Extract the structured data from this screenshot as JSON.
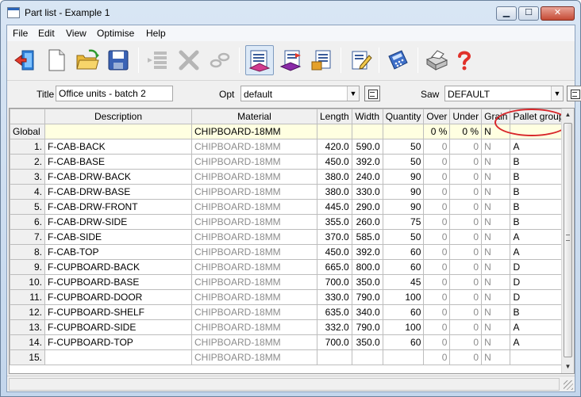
{
  "window": {
    "title": "Part list - Example 1",
    "controls": {
      "minimize": "▁",
      "maximize": "☐",
      "close": "✕"
    }
  },
  "menu": [
    "File",
    "Edit",
    "View",
    "Optimise",
    "Help"
  ],
  "toolbar": {
    "buttons": [
      {
        "name": "exit-icon"
      },
      {
        "name": "new-document-icon"
      },
      {
        "name": "open-folder-icon"
      },
      {
        "name": "save-disk-icon"
      },
      {
        "name": "insert-rows-icon"
      },
      {
        "name": "delete-cross-icon"
      },
      {
        "name": "link-chain-icon"
      },
      {
        "name": "parts-list-icon",
        "active": true
      },
      {
        "name": "board-list-icon"
      },
      {
        "name": "edge-list-icon"
      },
      {
        "name": "edit-properties-icon"
      },
      {
        "name": "calculator-icon"
      },
      {
        "name": "printer-icon"
      },
      {
        "name": "help-question-icon"
      }
    ]
  },
  "params": {
    "title_label": "Title",
    "title_value": "Office units - batch 2",
    "opt_label": "Opt",
    "opt_value": "default",
    "saw_label": "Saw",
    "saw_value": "DEFAULT"
  },
  "grid": {
    "columns": [
      "Description",
      "Material",
      "Length",
      "Width",
      "Quantity",
      "Over",
      "Under",
      "Grain",
      "Pallet group"
    ],
    "global": {
      "label": "Global",
      "material": "CHIPBOARD-18MM",
      "over": "0 %",
      "under": "0 %",
      "grain": "N"
    },
    "rows": [
      {
        "no": "1.",
        "description": "F-CAB-BACK",
        "material": "CHIPBOARD-18MM",
        "length": "420.0",
        "width": "590.0",
        "quantity": "50",
        "over": "0",
        "under": "0",
        "grain": "N",
        "pallet": "A"
      },
      {
        "no": "2.",
        "description": "F-CAB-BASE",
        "material": "CHIPBOARD-18MM",
        "length": "450.0",
        "width": "392.0",
        "quantity": "50",
        "over": "0",
        "under": "0",
        "grain": "N",
        "pallet": "B"
      },
      {
        "no": "3.",
        "description": "F-CAB-DRW-BACK",
        "material": "CHIPBOARD-18MM",
        "length": "380.0",
        "width": "240.0",
        "quantity": "90",
        "over": "0",
        "under": "0",
        "grain": "N",
        "pallet": "B"
      },
      {
        "no": "4.",
        "description": "F-CAB-DRW-BASE",
        "material": "CHIPBOARD-18MM",
        "length": "380.0",
        "width": "330.0",
        "quantity": "90",
        "over": "0",
        "under": "0",
        "grain": "N",
        "pallet": "B"
      },
      {
        "no": "5.",
        "description": "F-CAB-DRW-FRONT",
        "material": "CHIPBOARD-18MM",
        "length": "445.0",
        "width": "290.0",
        "quantity": "90",
        "over": "0",
        "under": "0",
        "grain": "N",
        "pallet": "B"
      },
      {
        "no": "6.",
        "description": "F-CAB-DRW-SIDE",
        "material": "CHIPBOARD-18MM",
        "length": "355.0",
        "width": "260.0",
        "quantity": "75",
        "over": "0",
        "under": "0",
        "grain": "N",
        "pallet": "B"
      },
      {
        "no": "7.",
        "description": "F-CAB-SIDE",
        "material": "CHIPBOARD-18MM",
        "length": "370.0",
        "width": "585.0",
        "quantity": "50",
        "over": "0",
        "under": "0",
        "grain": "N",
        "pallet": "A"
      },
      {
        "no": "8.",
        "description": "F-CAB-TOP",
        "material": "CHIPBOARD-18MM",
        "length": "450.0",
        "width": "392.0",
        "quantity": "60",
        "over": "0",
        "under": "0",
        "grain": "N",
        "pallet": "A"
      },
      {
        "no": "9.",
        "description": "F-CUPBOARD-BACK",
        "material": "CHIPBOARD-18MM",
        "length": "665.0",
        "width": "800.0",
        "quantity": "60",
        "over": "0",
        "under": "0",
        "grain": "N",
        "pallet": "D"
      },
      {
        "no": "10.",
        "description": "F-CUPBOARD-BASE",
        "material": "CHIPBOARD-18MM",
        "length": "700.0",
        "width": "350.0",
        "quantity": "45",
        "over": "0",
        "under": "0",
        "grain": "N",
        "pallet": "D"
      },
      {
        "no": "11.",
        "description": "F-CUPBOARD-DOOR",
        "material": "CHIPBOARD-18MM",
        "length": "330.0",
        "width": "790.0",
        "quantity": "100",
        "over": "0",
        "under": "0",
        "grain": "N",
        "pallet": "D"
      },
      {
        "no": "12.",
        "description": "F-CUPBOARD-SHELF",
        "material": "CHIPBOARD-18MM",
        "length": "635.0",
        "width": "340.0",
        "quantity": "60",
        "over": "0",
        "under": "0",
        "grain": "N",
        "pallet": "B"
      },
      {
        "no": "13.",
        "description": "F-CUPBOARD-SIDE",
        "material": "CHIPBOARD-18MM",
        "length": "332.0",
        "width": "790.0",
        "quantity": "100",
        "over": "0",
        "under": "0",
        "grain": "N",
        "pallet": "A"
      },
      {
        "no": "14.",
        "description": "F-CUPBOARD-TOP",
        "material": "CHIPBOARD-18MM",
        "length": "700.0",
        "width": "350.0",
        "quantity": "60",
        "over": "0",
        "under": "0",
        "grain": "N",
        "pallet": "A"
      },
      {
        "no": "15.",
        "description": "",
        "material": "CHIPBOARD-18MM",
        "length": "",
        "width": "",
        "quantity": "",
        "over": "0",
        "under": "0",
        "grain": "N",
        "pallet": ""
      }
    ]
  },
  "colors": {
    "annotation_circle": "#d8262a",
    "global_row_bg": "#ffffe1",
    "inherited_text": "#8c8c8c"
  }
}
